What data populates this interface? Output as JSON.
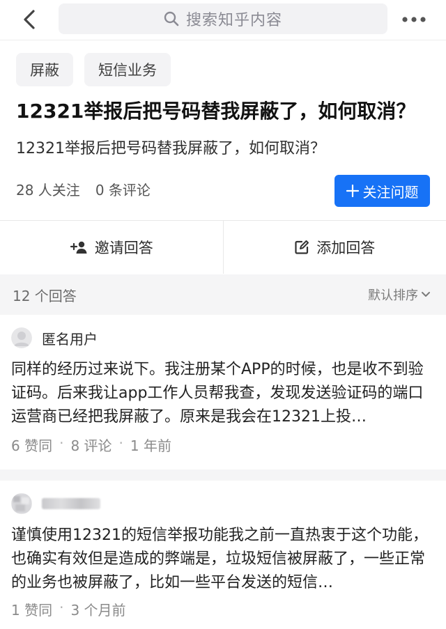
{
  "search": {
    "placeholder": "搜索知乎内容"
  },
  "question": {
    "tags": [
      "屏蔽",
      "短信业务"
    ],
    "title": "12321举报后把号码替我屏蔽了，如何取消？",
    "description": "12321举报后把号码替我屏蔽了，如何取消？",
    "followers": "28 人关注",
    "comments": "0 条评论",
    "follow_label": "关注问题"
  },
  "actions": {
    "invite": "邀请回答",
    "add_answer": "添加回答"
  },
  "answers_header": {
    "count": "12 个回答",
    "sort": "默认排序"
  },
  "answers": [
    {
      "author": "匿名用户",
      "excerpt": "同样的经历过来说下。我注册某个APP的时候，也是收不到验证码。后来我让app工作人员帮我查，发现发送验证码的端口运营商已经把我屏蔽了。原来是我会在12321上投…",
      "votes": "6 赞同",
      "comments": "8 评论",
      "time": "1 年前"
    },
    {
      "author": "",
      "excerpt": "谨慎使用12321的短信举报功能我之前一直热衷于这个功能，也确实有效但是造成的弊端是，垃圾短信被屏蔽了，一些正常的业务也被屏蔽了，比如一些平台发送的短信…",
      "votes": "1 赞同",
      "time": "3 个月前"
    }
  ],
  "colors": {
    "accent": "#1772f6",
    "band": "#f5f5f6"
  },
  "icons": [
    "chevron-left-icon",
    "search-icon",
    "more-icon",
    "plus-icon",
    "invite-user-icon",
    "edit-icon",
    "chevron-down-icon"
  ]
}
